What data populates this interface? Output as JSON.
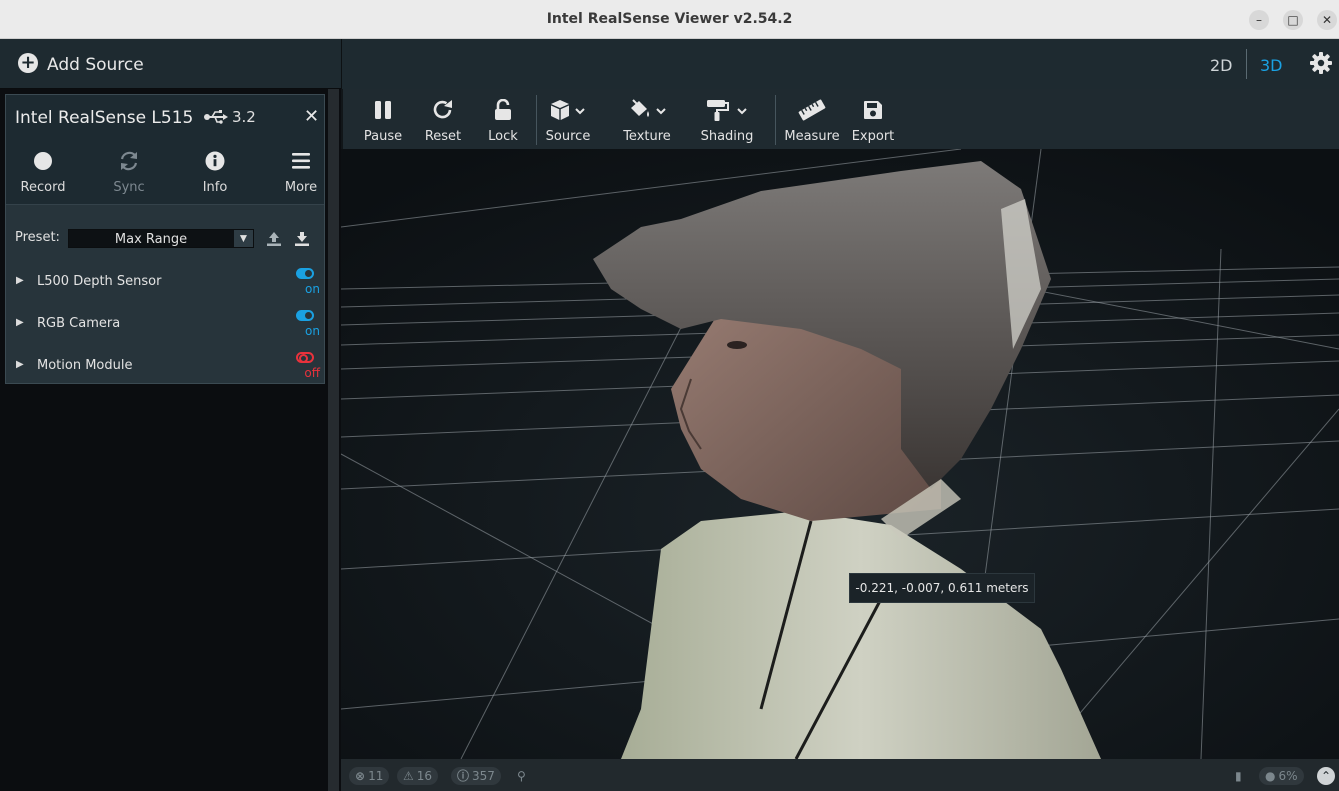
{
  "window": {
    "title": "Intel RealSense Viewer v2.54.2",
    "minimize_icon": "minimize-icon",
    "maximize_icon": "maximize-icon",
    "close_icon": "close-icon"
  },
  "sidebar": {
    "add_source_label": "Add Source",
    "device": {
      "name": "Intel RealSense L515",
      "usb": "3.2",
      "tools": [
        {
          "label": "Record",
          "icon": "record-icon",
          "enabled": true
        },
        {
          "label": "Sync",
          "icon": "sync-icon",
          "enabled": false
        },
        {
          "label": "Info",
          "icon": "info-icon",
          "enabled": true
        },
        {
          "label": "More",
          "icon": "menu-icon",
          "enabled": true
        }
      ],
      "preset_label": "Preset:",
      "preset_value": "Max Range",
      "sensors": [
        {
          "name": "L500 Depth Sensor",
          "state": "on"
        },
        {
          "name": "RGB Camera",
          "state": "on"
        },
        {
          "name": "Motion Module",
          "state": "off"
        }
      ]
    }
  },
  "view": {
    "modes": [
      "2D",
      "3D"
    ],
    "active_mode": "3D",
    "toolbar": [
      {
        "label": "Pause",
        "icon": "pause-icon"
      },
      {
        "label": "Reset",
        "icon": "reset-icon"
      },
      {
        "label": "Lock",
        "icon": "lock-icon"
      },
      {
        "label": "Source",
        "icon": "cube-icon"
      },
      {
        "label": "Texture",
        "icon": "paint-bucket-icon"
      },
      {
        "label": "Shading",
        "icon": "paint-roller-icon"
      },
      {
        "label": "Measure",
        "icon": "ruler-icon"
      },
      {
        "label": "Export",
        "icon": "save-icon"
      }
    ],
    "tooltip": "-0.221, -0.007, 0.611 meters"
  },
  "statusbar": {
    "errors": "11",
    "warnings": "16",
    "info": "357",
    "zoom": "6%"
  },
  "colors": {
    "accent": "#1aa1e2",
    "off": "#e8323c",
    "panel": "#27343b",
    "header": "#1e2a30"
  }
}
